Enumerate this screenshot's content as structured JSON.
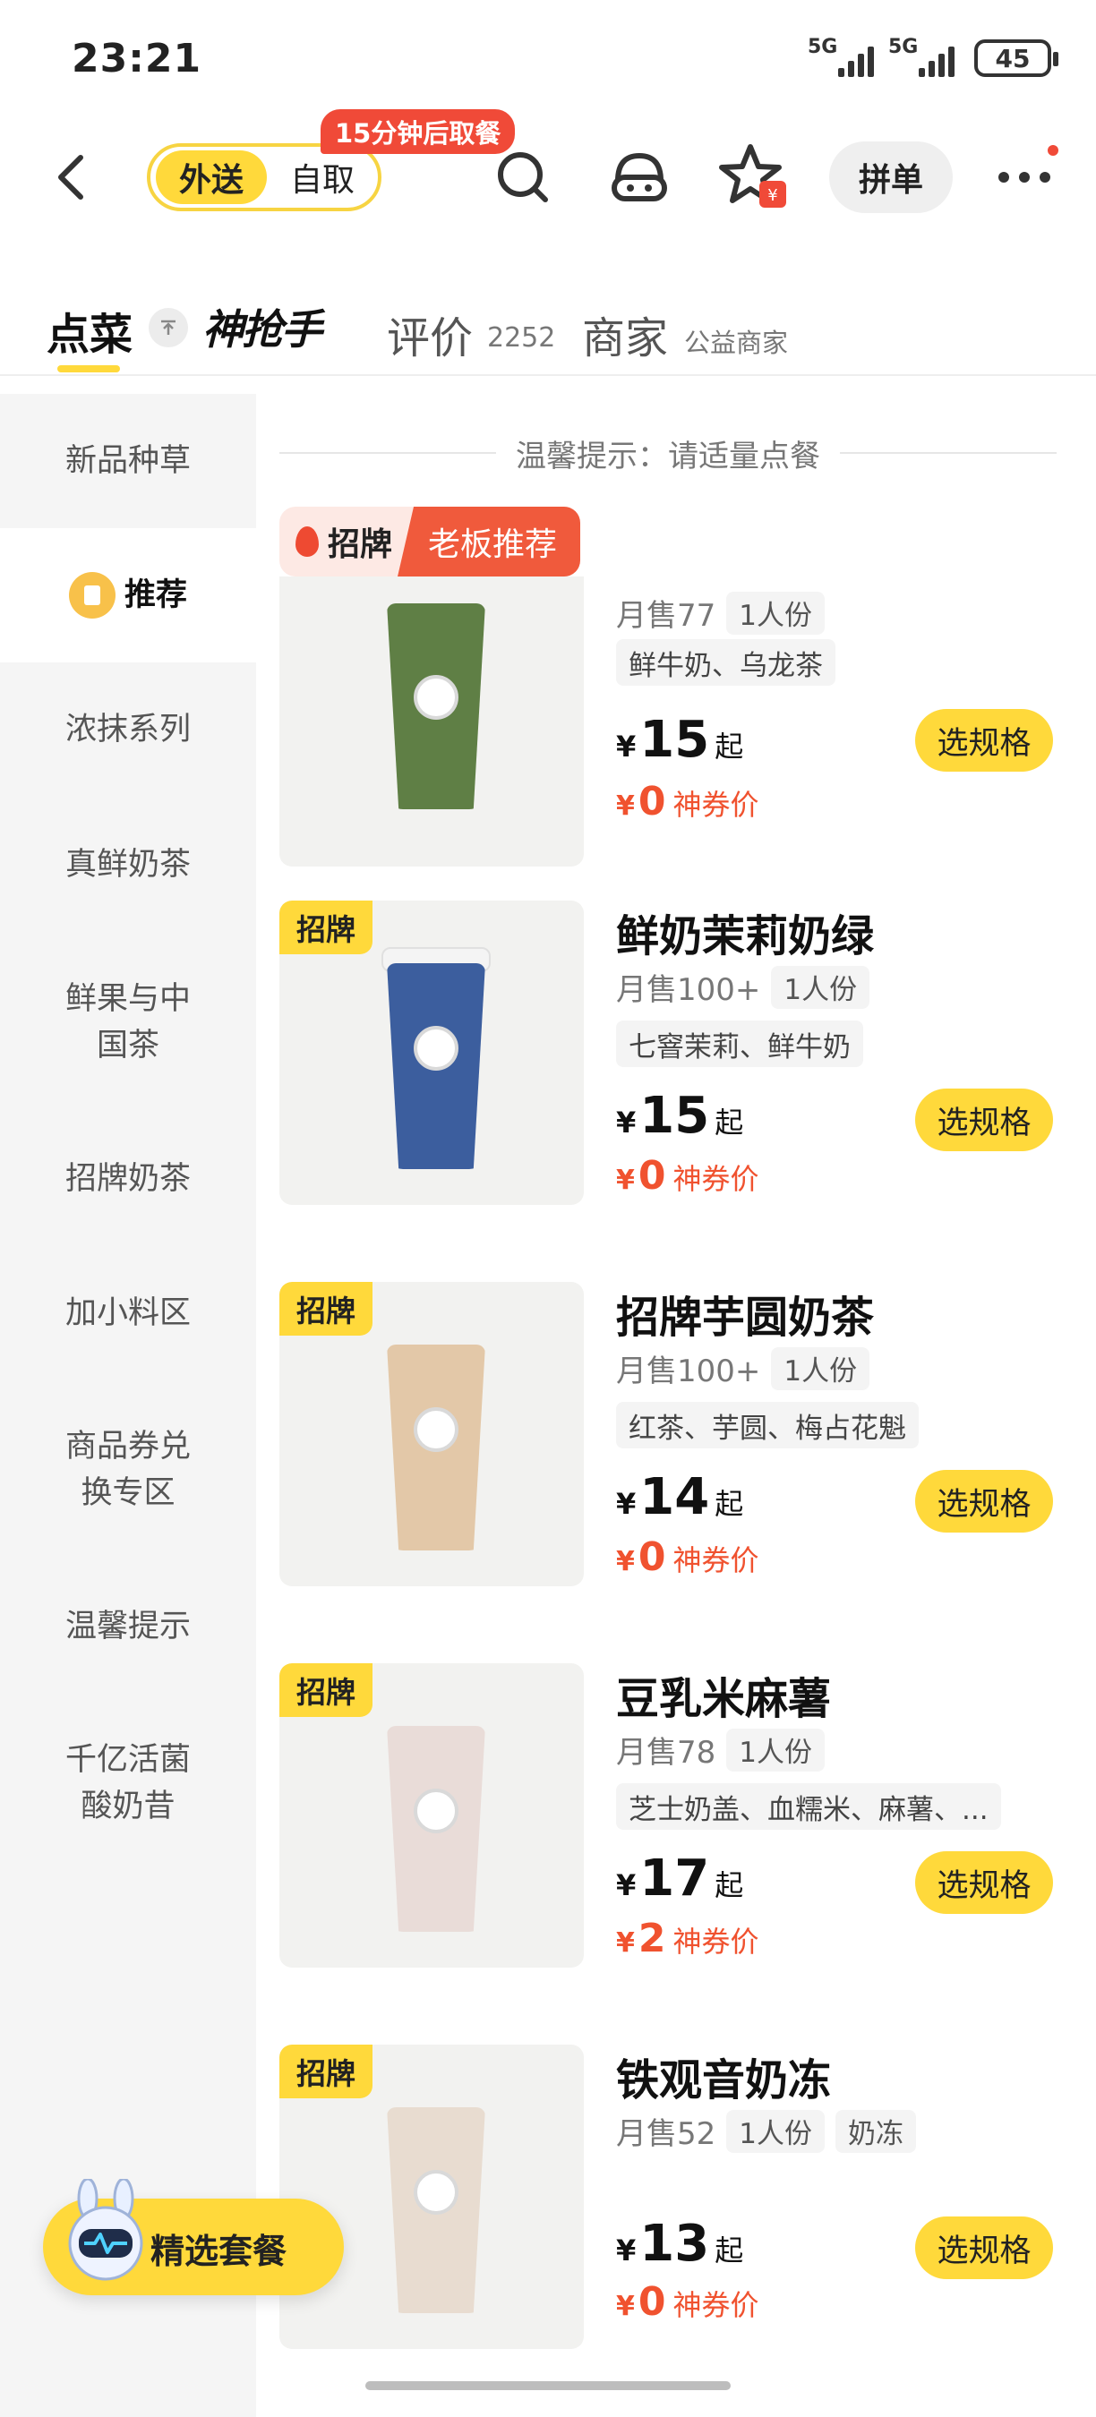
{
  "status_bar": {
    "time": "23:21",
    "signal_1": "5G",
    "signal_2": "5G",
    "battery": "45"
  },
  "header": {
    "mode_active": "外送",
    "mode_other": "自取",
    "pickup_badge": "15分钟后取餐",
    "group_order": "拼单",
    "icons": [
      "back-icon",
      "search-icon",
      "customer-service-icon",
      "favorite-star-icon",
      "more-icon"
    ],
    "accent": "#FFD93B",
    "badge_color": "#F04A38"
  },
  "tabs": {
    "order": "点菜",
    "logo": "神抢手",
    "reviews": "评价",
    "reviews_count": "2252",
    "merchant": "商家",
    "merchant_sub": "公益商家"
  },
  "sidebar": {
    "items": [
      {
        "label": "新品种草"
      },
      {
        "label": "推荐",
        "active": true
      },
      {
        "label": "浓抹系列"
      },
      {
        "label": "真鲜奶茶"
      },
      {
        "label": "鲜果与中国茶"
      },
      {
        "label": "招牌奶茶"
      },
      {
        "label": "加小料区"
      },
      {
        "label": "商品券兑换专区"
      },
      {
        "label": "温馨提示"
      },
      {
        "label": "千亿活菌酸奶昔"
      }
    ]
  },
  "notice": "温馨提示：请适量点餐",
  "section_tag": {
    "left": "招牌",
    "right": "老板推荐"
  },
  "products": [
    {
      "badge": "",
      "name": "",
      "sales": "月售77",
      "portion": "1人份",
      "extra_tag": "",
      "ingredients": "鲜牛奶、乌龙茶",
      "price": "15",
      "price_suffix": "起",
      "coupon_price": "0",
      "coupon_label": "神券价",
      "spec_button": "选规格",
      "cup_color": "#5F7F45"
    },
    {
      "badge": "招牌",
      "name": "鲜奶茉莉奶绿",
      "sales": "月售100+",
      "portion": "1人份",
      "extra_tag": "",
      "ingredients": "七窨茉莉、鲜牛奶",
      "price": "15",
      "price_suffix": "起",
      "coupon_price": "0",
      "coupon_label": "神券价",
      "spec_button": "选规格",
      "cup_color": "#3C5E9E"
    },
    {
      "badge": "招牌",
      "name": "招牌芋圆奶茶",
      "sales": "月售100+",
      "portion": "1人份",
      "extra_tag": "",
      "ingredients": "红茶、芋圆、梅占花魁",
      "price": "14",
      "price_suffix": "起",
      "coupon_price": "0",
      "coupon_label": "神券价",
      "spec_button": "选规格",
      "cup_color": "#E3C8A8"
    },
    {
      "badge": "招牌",
      "name": "豆乳米麻薯",
      "sales": "月售78",
      "portion": "1人份",
      "extra_tag": "",
      "ingredients": "芝士奶盖、血糯米、麻薯、...",
      "price": "17",
      "price_suffix": "起",
      "coupon_price": "2",
      "coupon_label": "神券价",
      "spec_button": "选规格",
      "cup_color": "#E9DCD8"
    },
    {
      "badge": "招牌",
      "name": "铁观音奶冻",
      "sales": "月售52",
      "portion": "1人份",
      "extra_tag": "奶冻",
      "ingredients": "",
      "price": "13",
      "price_suffix": "起",
      "coupon_price": "0",
      "coupon_label": "神券价",
      "spec_button": "选规格",
      "cup_color": "#E8DCD0"
    }
  ],
  "currency": "¥",
  "combo_button": "精选套餐"
}
